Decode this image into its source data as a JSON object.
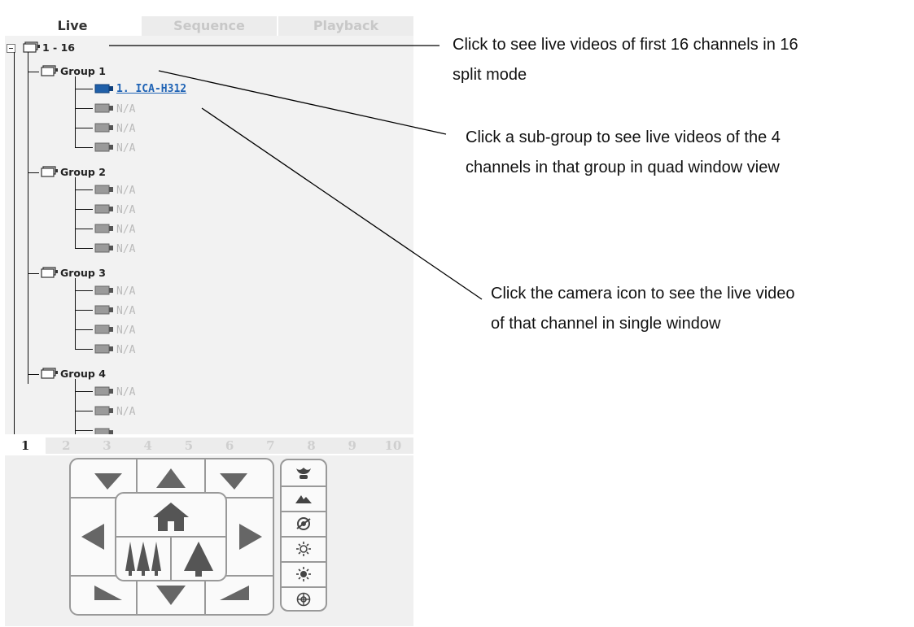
{
  "tabs": [
    {
      "label": "Live",
      "active": true
    },
    {
      "label": "Sequence",
      "active": false
    },
    {
      "label": "Playback",
      "active": false
    }
  ],
  "tree": {
    "root_label": "1 - 16",
    "groups": [
      {
        "label": "Group 1",
        "channels": [
          "1. ICA-H312",
          "N/A",
          "N/A",
          "N/A"
        ]
      },
      {
        "label": "Group 2",
        "channels": [
          "N/A",
          "N/A",
          "N/A",
          "N/A"
        ]
      },
      {
        "label": "Group 3",
        "channels": [
          "N/A",
          "N/A",
          "N/A",
          "N/A"
        ]
      },
      {
        "label": "Group 4",
        "channels": [
          "N/A",
          "N/A"
        ]
      }
    ]
  },
  "channel_numbers": [
    "1",
    "2",
    "3",
    "4",
    "5",
    "6",
    "7",
    "8",
    "9",
    "10"
  ],
  "active_channel": "1",
  "ptz": {
    "side_icons": [
      "zoom-in-icon",
      "zoom-out-icon",
      "focus-icon",
      "iris-open-icon",
      "iris-close-icon",
      "auto-focus-icon"
    ]
  },
  "annotations": {
    "root_note_line1": "Click to see live videos of first 16 channels in 16",
    "root_note_line2": "split mode",
    "group_note_line1": "Click a sub-group to see live videos of the 4",
    "group_note_line2": "channels in that group in quad window view",
    "camera_note_line1": "Click the camera icon to see the live video",
    "camera_note_line2": "of that channel in single window"
  },
  "colors": {
    "active_camera": "#1f5fa8",
    "inactive_camera": "#9a9a9a",
    "link": "#1f63b5"
  }
}
